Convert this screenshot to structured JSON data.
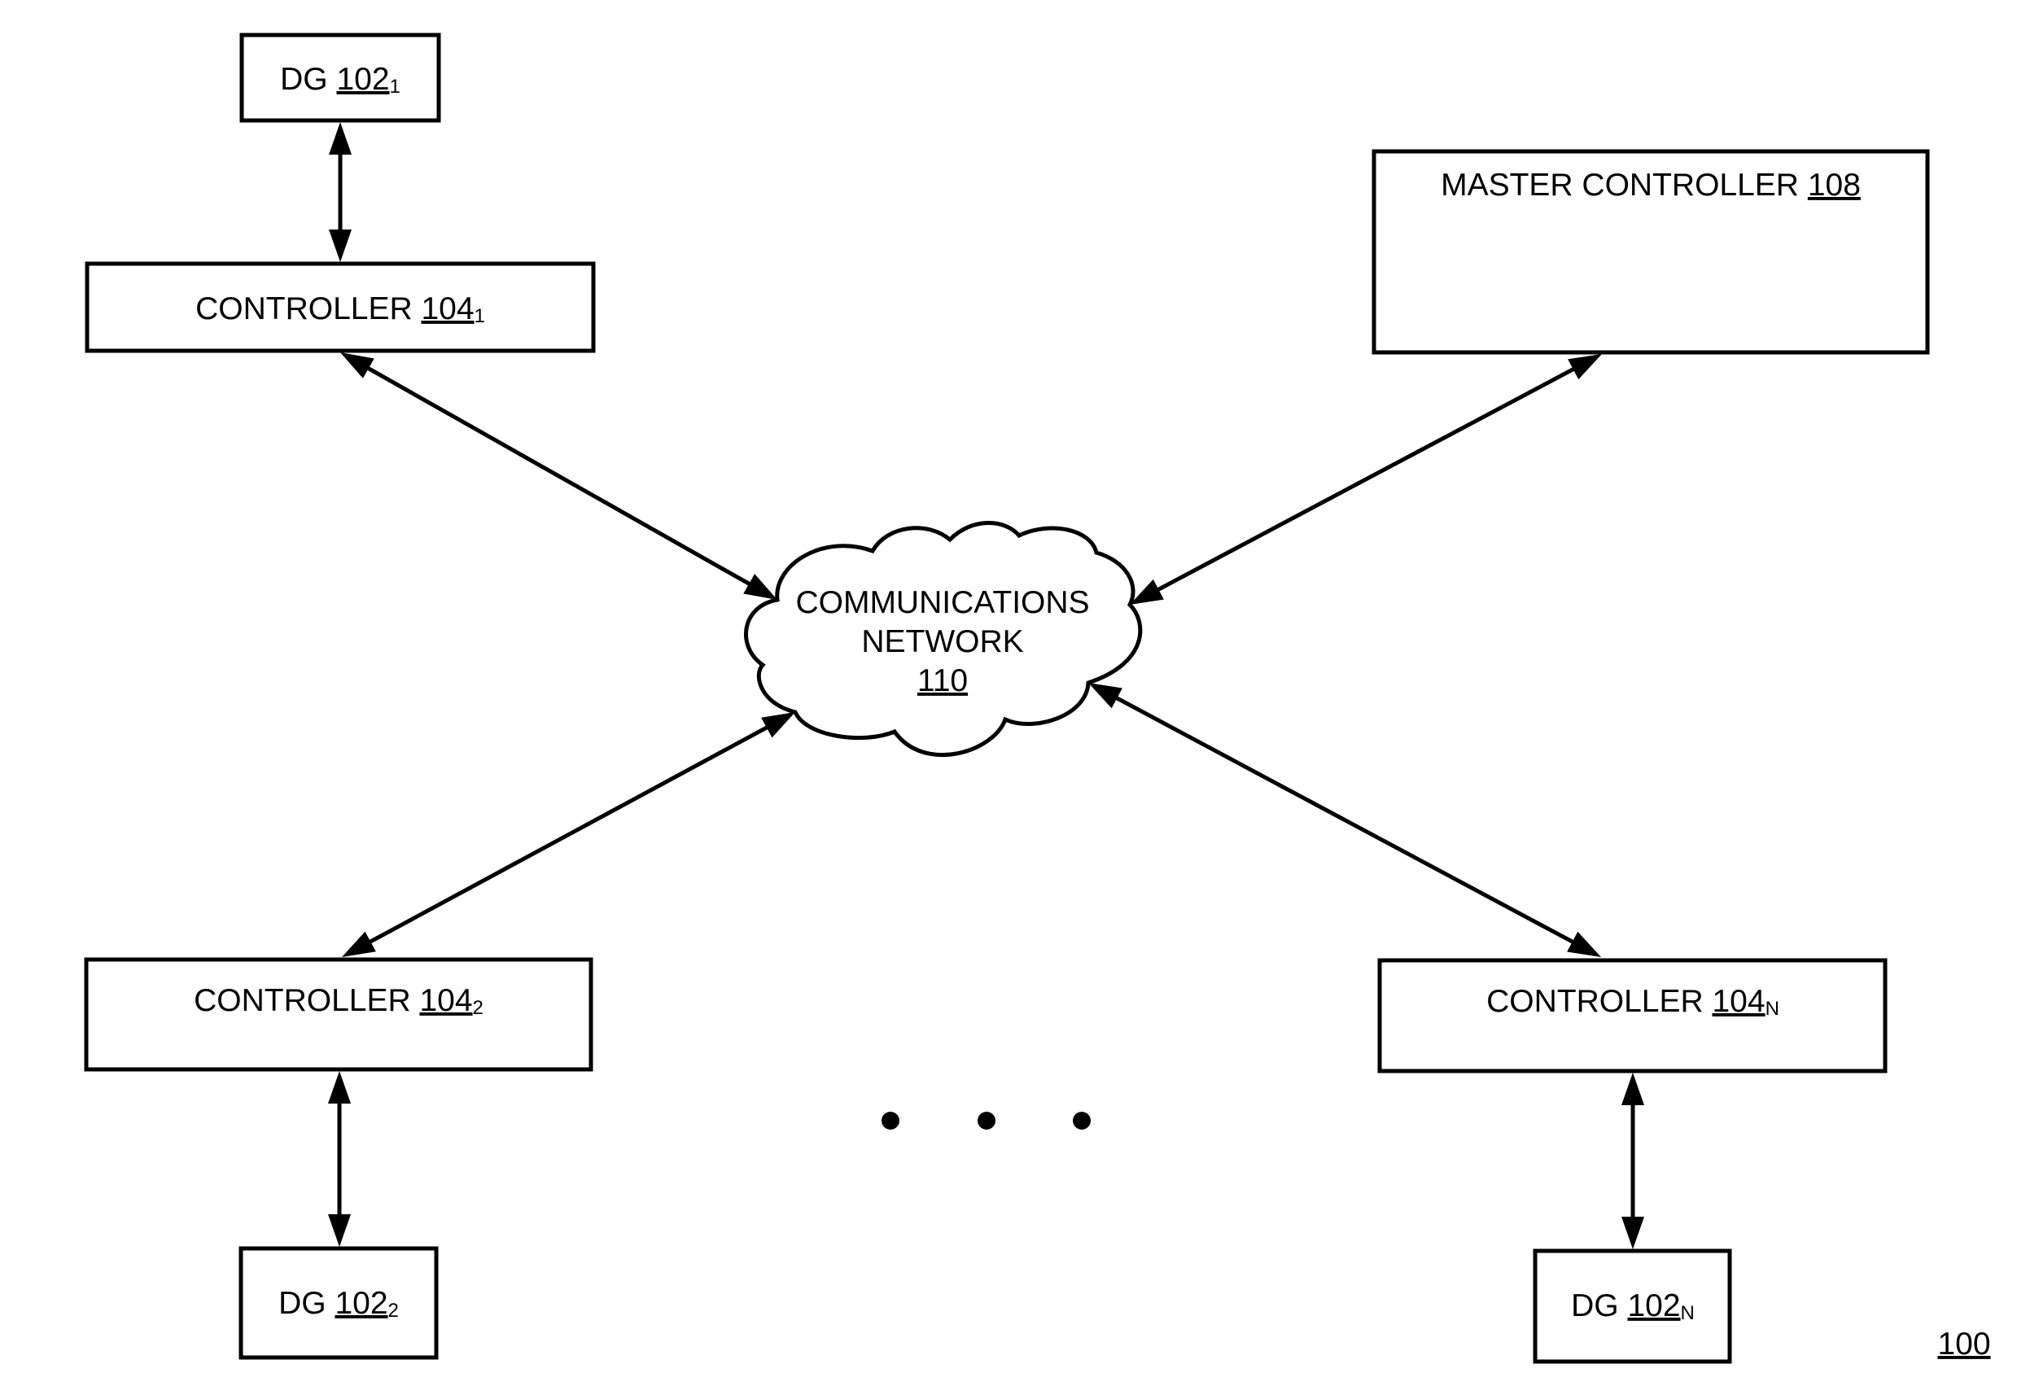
{
  "figure": {
    "reference": "100",
    "nodes": {
      "dg1": {
        "name": "DG",
        "ref": "102",
        "sub": "1"
      },
      "controller1": {
        "name": "CONTROLLER",
        "ref": "104",
        "sub": "1"
      },
      "master": {
        "name": "MASTER CONTROLLER",
        "ref": "108"
      },
      "network": {
        "line1": "COMMUNICATIONS",
        "line2": "NETWORK",
        "ref": "110"
      },
      "controller2": {
        "name": "CONTROLLER",
        "ref": "104",
        "sub": "2"
      },
      "dg2": {
        "name": "DG",
        "ref": "102",
        "sub": "2"
      },
      "controllerN": {
        "name": "CONTROLLER",
        "ref": "104",
        "sub": "N"
      },
      "dgN": {
        "name": "DG",
        "ref": "102",
        "sub": "N"
      }
    },
    "connections": [
      {
        "from": "dg1",
        "to": "controller1",
        "bidirectional": true
      },
      {
        "from": "controller1",
        "to": "network",
        "bidirectional": true
      },
      {
        "from": "master",
        "to": "network",
        "bidirectional": true
      },
      {
        "from": "controller2",
        "to": "network",
        "bidirectional": true
      },
      {
        "from": "controllerN",
        "to": "network",
        "bidirectional": true
      },
      {
        "from": "controller2",
        "to": "dg2",
        "bidirectional": true
      },
      {
        "from": "controllerN",
        "to": "dgN",
        "bidirectional": true
      }
    ],
    "ellipsis": "• • •"
  }
}
